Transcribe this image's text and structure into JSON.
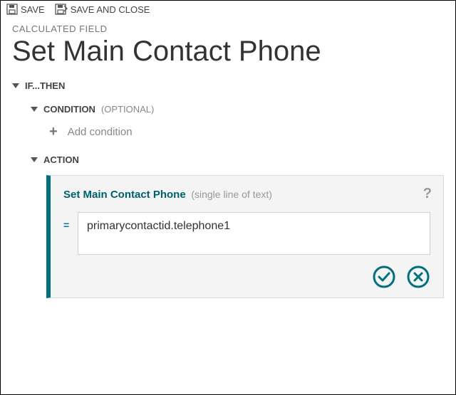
{
  "toolbar": {
    "save_label": "SAVE",
    "save_close_label": "SAVE AND CLOSE"
  },
  "header": {
    "eyebrow": "CALCULATED FIELD",
    "title": "Set Main Contact Phone"
  },
  "ifthen": {
    "label": "IF...THEN",
    "condition": {
      "label": "CONDITION",
      "optional": "(OPTIONAL)",
      "add_label": "Add condition"
    },
    "action": {
      "label": "ACTION",
      "field_name": "Set Main Contact Phone",
      "field_type": "(single line of text)",
      "formula_value": "primarycontactid.telephone1"
    }
  },
  "colors": {
    "accent": "#00707e"
  }
}
